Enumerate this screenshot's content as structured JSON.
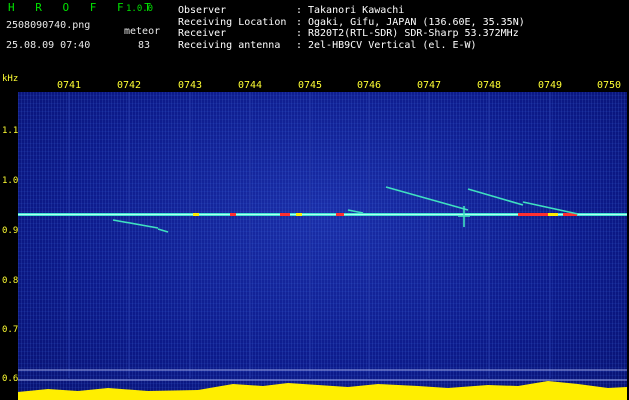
{
  "app": {
    "title": "H R O F F T",
    "version": "1.0.0"
  },
  "file": {
    "name": "2508090740.png",
    "datetime": "25.08.09 07:40"
  },
  "detection": {
    "label": "meteor",
    "count": "83"
  },
  "info": [
    {
      "label": "Observer",
      "value": "Takanori Kawachi"
    },
    {
      "label": "Receiving Location",
      "value": "Ogaki, Gifu, JAPAN (136.60E, 35.35N)"
    },
    {
      "label": "Receiver",
      "value": "R820T2(RTL-SDR) SDR-Sharp 53.372MHz"
    },
    {
      "label": "Receiving antenna",
      "value": "2el-HB9CV Vertical (el. E-W)"
    }
  ],
  "axis": {
    "unit": "kHz",
    "time_ticks": [
      "0741",
      "0742",
      "0743",
      "0744",
      "0745",
      "0746",
      "0747",
      "0748",
      "0749",
      "0750"
    ],
    "freq_ticks": [
      "1.1",
      "1.0",
      "0.9",
      "0.8",
      "0.7",
      "0.6"
    ]
  },
  "colors": {
    "title": "#00e000",
    "axis": "#ffff33",
    "background": "#0c1a8a",
    "carrier": "#40e0d0"
  }
}
